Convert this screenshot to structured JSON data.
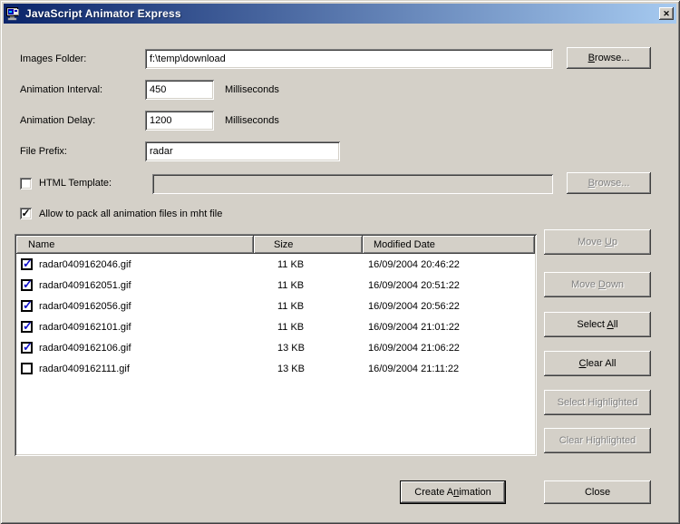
{
  "window": {
    "title": "JavaScript Animator Express"
  },
  "icons": {
    "close": "✕"
  },
  "fields": {
    "images_folder": {
      "label": "Images Folder:",
      "value": "f:\\temp\\download"
    },
    "animation_interval": {
      "label": "Animation Interval:",
      "value": "450",
      "unit": "Milliseconds"
    },
    "animation_delay": {
      "label": "Animation Delay:",
      "value": "1200",
      "unit": "Milliseconds"
    },
    "file_prefix": {
      "label": "File Prefix:",
      "value": "radar"
    },
    "html_template": {
      "label": "HTML Template:",
      "value": "",
      "checked": false
    },
    "pack_mht": {
      "label": "Allow to pack all animation files in mht file",
      "checked": true
    }
  },
  "buttons": {
    "browse_images": {
      "pre": "",
      "key": "B",
      "post": "rowse..."
    },
    "browse_template": {
      "pre": "",
      "key": "B",
      "post": "rowse..."
    },
    "move_up": {
      "pre": "Move ",
      "key": "U",
      "post": "p"
    },
    "move_down": {
      "pre": "Move ",
      "key": "D",
      "post": "own"
    },
    "select_all": {
      "pre": "Select ",
      "key": "A",
      "post": "ll"
    },
    "clear_all": {
      "pre": "",
      "key": "C",
      "post": "lear All"
    },
    "select_highlighted": {
      "label": "Select Highlighted"
    },
    "clear_highlighted": {
      "label": "Clear Highlighted"
    },
    "create_animation": {
      "pre": "Create A",
      "key": "n",
      "post": "imation"
    },
    "close": {
      "label": "Close"
    }
  },
  "list": {
    "columns": [
      "Name",
      "Size",
      "Modified Date"
    ],
    "rows": [
      {
        "checked": true,
        "name": "radar0409162046.gif",
        "size": "11 KB",
        "modified": "16/09/2004 20:46:22"
      },
      {
        "checked": true,
        "name": "radar0409162051.gif",
        "size": "11 KB",
        "modified": "16/09/2004 20:51:22"
      },
      {
        "checked": true,
        "name": "radar0409162056.gif",
        "size": "11 KB",
        "modified": "16/09/2004 20:56:22"
      },
      {
        "checked": true,
        "name": "radar0409162101.gif",
        "size": "11 KB",
        "modified": "16/09/2004 21:01:22"
      },
      {
        "checked": true,
        "name": "radar0409162106.gif",
        "size": "13 KB",
        "modified": "16/09/2004 21:06:22"
      },
      {
        "checked": false,
        "name": "radar0409162111.gif",
        "size": "13 KB",
        "modified": "16/09/2004 21:11:22"
      }
    ]
  },
  "colors": {
    "titlebar_start": "#0a246a",
    "titlebar_end": "#a6caf0",
    "face": "#d4d0c8",
    "check_blue": "#1414cc"
  }
}
